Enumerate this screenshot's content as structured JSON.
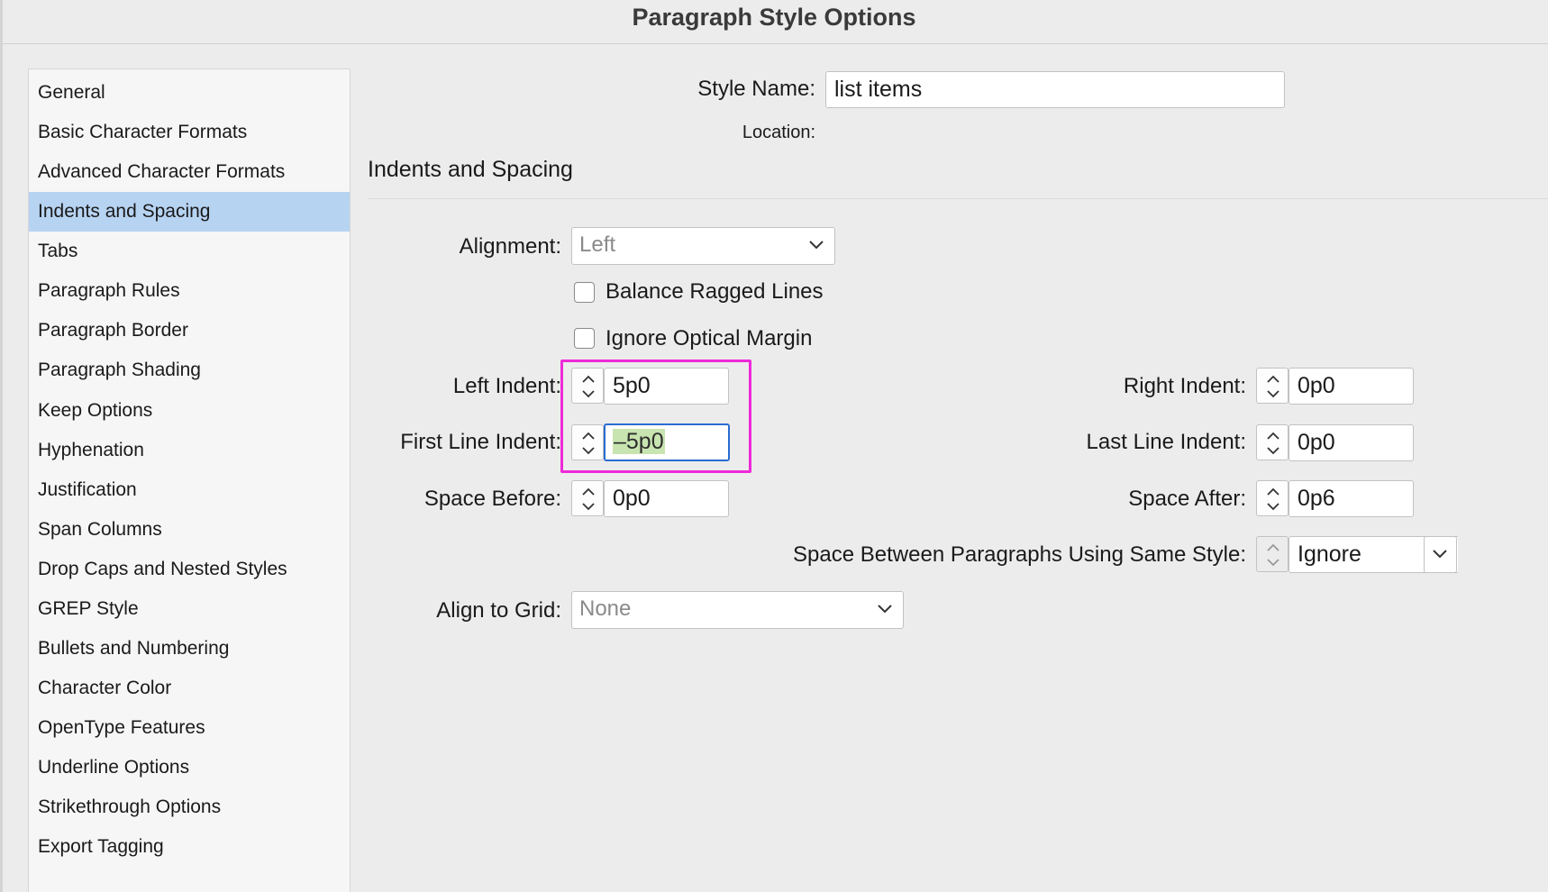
{
  "window": {
    "title": "Paragraph Style Options"
  },
  "sidebar": {
    "items": [
      {
        "label": "General"
      },
      {
        "label": "Basic Character Formats"
      },
      {
        "label": "Advanced Character Formats"
      },
      {
        "label": "Indents and Spacing",
        "selected": true
      },
      {
        "label": "Tabs"
      },
      {
        "label": "Paragraph Rules"
      },
      {
        "label": "Paragraph Border"
      },
      {
        "label": "Paragraph Shading"
      },
      {
        "label": "Keep Options"
      },
      {
        "label": "Hyphenation"
      },
      {
        "label": "Justification"
      },
      {
        "label": "Span Columns"
      },
      {
        "label": "Drop Caps and Nested Styles"
      },
      {
        "label": "GREP Style"
      },
      {
        "label": "Bullets and Numbering"
      },
      {
        "label": "Character Color"
      },
      {
        "label": "OpenType Features"
      },
      {
        "label": "Underline Options"
      },
      {
        "label": "Strikethrough Options"
      },
      {
        "label": "Export Tagging"
      }
    ]
  },
  "header": {
    "style_name_label": "Style Name:",
    "style_name_value": "list items",
    "location_label": "Location:"
  },
  "section": {
    "title": "Indents and Spacing"
  },
  "form": {
    "alignment": {
      "label": "Alignment:",
      "value": "Left"
    },
    "balance_ragged_lines": {
      "label": "Balance Ragged Lines",
      "checked": false
    },
    "ignore_optical_margin": {
      "label": "Ignore Optical Margin",
      "checked": false
    },
    "left_indent": {
      "label": "Left Indent:",
      "value": "5p0"
    },
    "first_line_indent": {
      "label": "First Line Indent:",
      "value": "–5p0"
    },
    "space_before": {
      "label": "Space Before:",
      "value": "0p0"
    },
    "right_indent": {
      "label": "Right Indent:",
      "value": "0p0"
    },
    "last_line_indent": {
      "label": "Last Line Indent:",
      "value": "0p0"
    },
    "space_after": {
      "label": "Space After:",
      "value": "0p6"
    },
    "space_between": {
      "label": "Space Between Paragraphs Using Same Style:",
      "value": "Ignore"
    },
    "align_to_grid": {
      "label": "Align to Grid:",
      "value": "None"
    }
  },
  "colors": {
    "selected_row": "#b7d3f2",
    "focus_border": "#2a6cd0",
    "annotation": "#ee2ad8",
    "text_selection": "#c8e4b0"
  }
}
